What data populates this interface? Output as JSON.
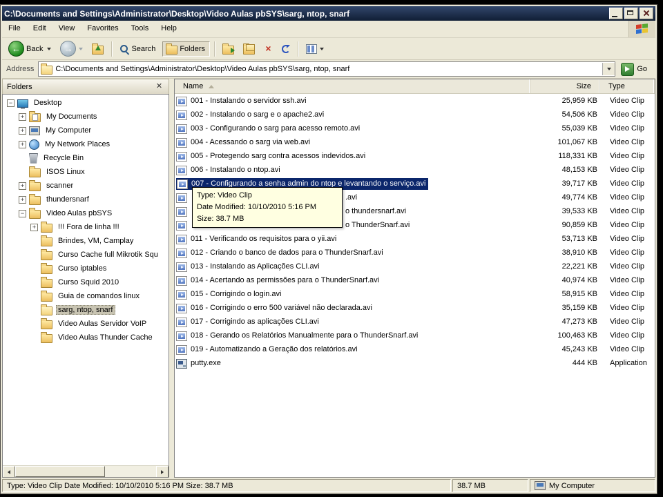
{
  "colors": {
    "window_face": "#ece9d8",
    "selection_blue": "#0b266b",
    "tooltip_yellow": "#ffffe1",
    "titlebar_dark": "#101e35"
  },
  "window": {
    "title": "C:\\Documents and Settings\\Administrator\\Desktop\\Video Aulas pbSYS\\sarg, ntop, snarf",
    "controls": [
      "minimize",
      "maximize",
      "close"
    ]
  },
  "menu": {
    "items": [
      "File",
      "Edit",
      "View",
      "Favorites",
      "Tools",
      "Help"
    ]
  },
  "toolbar": {
    "back_label": "Back",
    "search_label": "Search",
    "folders_label": "Folders"
  },
  "address": {
    "label": "Address",
    "value": "C:\\Documents and Settings\\Administrator\\Desktop\\Video Aulas pbSYS\\sarg, ntop, snarf",
    "go_label": "Go"
  },
  "folders_panel": {
    "title": "Folders",
    "tree": [
      {
        "label": "Desktop",
        "icon": "desktop",
        "depth": 0,
        "expand": "minus"
      },
      {
        "label": "My Documents",
        "icon": "mydocs",
        "depth": 1,
        "expand": "plus"
      },
      {
        "label": "My Computer",
        "icon": "computer",
        "depth": 1,
        "expand": "plus"
      },
      {
        "label": "My Network Places",
        "icon": "network",
        "depth": 1,
        "expand": "plus"
      },
      {
        "label": "Recycle Bin",
        "icon": "recycle",
        "depth": 1,
        "expand": "none"
      },
      {
        "label": "ISOS Linux",
        "icon": "folder",
        "depth": 1,
        "expand": "none"
      },
      {
        "label": "scanner",
        "icon": "folder",
        "depth": 1,
        "expand": "plus"
      },
      {
        "label": "thundersnarf",
        "icon": "folder",
        "depth": 1,
        "expand": "plus"
      },
      {
        "label": "Video Aulas pbSYS",
        "icon": "folder",
        "depth": 1,
        "expand": "minus"
      },
      {
        "label": "!!! Fora de linha !!!",
        "icon": "folder",
        "depth": 2,
        "expand": "plus"
      },
      {
        "label": "Brindes, VM, Camplay",
        "icon": "folder",
        "depth": 2,
        "expand": "none"
      },
      {
        "label": "Curso Cache full Mikrotik Squ",
        "icon": "folder",
        "depth": 2,
        "expand": "none"
      },
      {
        "label": "Curso iptables",
        "icon": "folder",
        "depth": 2,
        "expand": "none"
      },
      {
        "label": "Curso Squid 2010",
        "icon": "folder",
        "depth": 2,
        "expand": "none"
      },
      {
        "label": "Guia de comandos linux",
        "icon": "folder",
        "depth": 2,
        "expand": "none"
      },
      {
        "label": "sarg, ntop, snarf",
        "icon": "folder-open",
        "depth": 2,
        "expand": "none",
        "selected": true
      },
      {
        "label": "Video Aulas Servidor VoIP",
        "icon": "folder",
        "depth": 2,
        "expand": "none"
      },
      {
        "label": "Video Aulas Thunder Cache",
        "icon": "folder",
        "depth": 2,
        "expand": "none"
      }
    ]
  },
  "file_list": {
    "columns": [
      {
        "key": "name",
        "label": "Name"
      },
      {
        "key": "size",
        "label": "Size"
      },
      {
        "key": "type",
        "label": "Type"
      }
    ],
    "rows": [
      {
        "name": "001 - Instalando o servidor ssh.avi",
        "size": "25,959 KB",
        "type": "Video Clip",
        "icon": "video"
      },
      {
        "name": "002 - Instalando o sarg e o apache2.avi",
        "size": "54,506 KB",
        "type": "Video Clip",
        "icon": "video"
      },
      {
        "name": "003 - Configurando o sarg para acesso remoto.avi",
        "size": "55,039 KB",
        "type": "Video Clip",
        "icon": "video"
      },
      {
        "name": "004 - Acessando o sarg via web.avi",
        "size": "101,067 KB",
        "type": "Video Clip",
        "icon": "video"
      },
      {
        "name": "005 - Protegendo sarg contra acessos indevidos.avi",
        "size": "118,331 KB",
        "type": "Video Clip",
        "icon": "video"
      },
      {
        "name": "006 - Instalando o ntop.avi",
        "size": "48,153 KB",
        "type": "Video Clip",
        "icon": "video"
      },
      {
        "name": "007 - Configurando a senha admin do ntop e levantando o serviço.avi",
        "size": "39,717 KB",
        "type": "Video Clip",
        "icon": "video",
        "selected": true
      },
      {
        "name": ".avi",
        "size": "49,774 KB",
        "type": "Video Clip",
        "icon": "video",
        "obscured": true
      },
      {
        "name": "o thundersnarf.avi",
        "size": "39,533 KB",
        "type": "Video Clip",
        "icon": "video",
        "obscured": true
      },
      {
        "name": "o ThunderSnarf.avi",
        "size": "90,859 KB",
        "type": "Video Clip",
        "icon": "video",
        "obscured": true
      },
      {
        "name": "011 - Verificando os requisitos para o yii.avi",
        "size": "53,713 KB",
        "type": "Video Clip",
        "icon": "video"
      },
      {
        "name": "012 - Criando o banco de dados para o ThunderSnarf.avi",
        "size": "38,910 KB",
        "type": "Video Clip",
        "icon": "video"
      },
      {
        "name": "013 - Instalando as Aplicações CLI.avi",
        "size": "22,221 KB",
        "type": "Video Clip",
        "icon": "video"
      },
      {
        "name": "014 - Acertando as permissões para o ThunderSnarf.avi",
        "size": "40,974 KB",
        "type": "Video Clip",
        "icon": "video"
      },
      {
        "name": "015 - Corrigindo o login.avi",
        "size": "58,915 KB",
        "type": "Video Clip",
        "icon": "video"
      },
      {
        "name": "016 - Corrigindo o erro 500 variável não declarada.avi",
        "size": "35,159 KB",
        "type": "Video Clip",
        "icon": "video"
      },
      {
        "name": "017 - Corrigindo as aplicações CLI.avi",
        "size": "47,273 KB",
        "type": "Video Clip",
        "icon": "video"
      },
      {
        "name": "018 - Gerando os Relatórios Manualmente para o ThunderSnarf.avi",
        "size": "100,463 KB",
        "type": "Video Clip",
        "icon": "video"
      },
      {
        "name": "019 - Automatizando a Geração dos relatórios.avi",
        "size": "45,243 KB",
        "type": "Video Clip",
        "icon": "video"
      },
      {
        "name": "putty.exe",
        "size": "444 KB",
        "type": "Application",
        "icon": "app"
      }
    ]
  },
  "tooltip": {
    "lines": [
      "Type: Video Clip",
      "Date Modified: 10/10/2010 5:16 PM",
      "Size: 38.7 MB"
    ]
  },
  "status_bar": {
    "left": "Type: Video Clip Date Modified: 10/10/2010 5:16 PM Size: 38.7 MB",
    "middle": "38.7 MB",
    "right": "My Computer"
  }
}
